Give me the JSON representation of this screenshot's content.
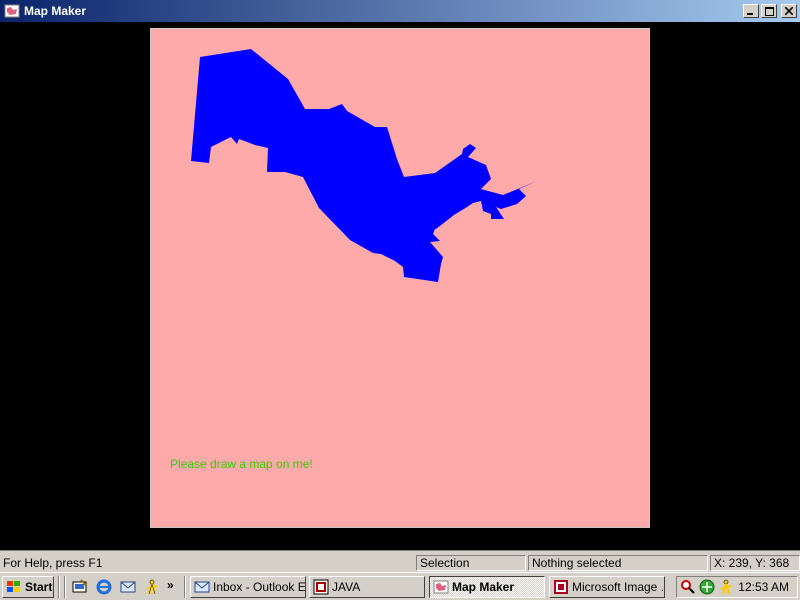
{
  "window": {
    "title": "Map Maker",
    "icon": "map-maker-app-icon",
    "buttons": {
      "minimize": "minimize-icon",
      "maximize": "maximize-icon",
      "close": "close-icon"
    }
  },
  "canvas": {
    "background": "#ffaaaa",
    "shape_color": "#0000ff",
    "hint": "Please draw a map on me!",
    "hint_color": "#33cc00"
  },
  "statusbar": {
    "help": "For Help, press F1",
    "mode": "Selection",
    "selection": "Nothing selected",
    "coords": "X: 239, Y: 368"
  },
  "taskbar": {
    "start_label": "Start",
    "quick_launch": [
      "show-desktop-icon",
      "internet-explorer-icon",
      "outlook-express-icon",
      "aim-icon"
    ],
    "chevron": "»",
    "tasks": [
      {
        "label": "Inbox - Outlook E...",
        "icon": "outlook-express-icon",
        "active": false
      },
      {
        "label": "JAVA",
        "icon": "java-icon",
        "active": false
      },
      {
        "label": "Map Maker",
        "icon": "map-maker-app-icon",
        "active": true
      },
      {
        "label": "Microsoft Image ...",
        "icon": "image-composer-icon",
        "active": false
      }
    ],
    "tray_icons": [
      "search-icon",
      "network-icon",
      "aim-icon"
    ],
    "clock": "12:53 AM"
  }
}
